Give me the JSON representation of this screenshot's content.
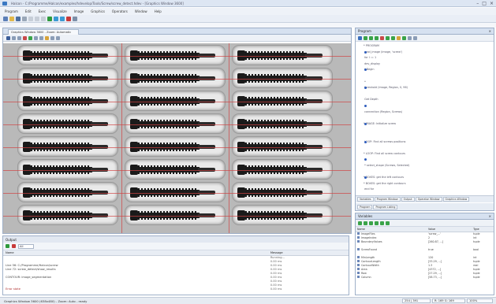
{
  "window": {
    "title": "Halcon - C:/Programme/Halcon/examples/hdevelop/Tools/Screw/screw_detect.hdev - [Graphics Window 3600]",
    "controls": [
      "minimize-icon",
      "maximize-icon",
      "close-icon"
    ]
  },
  "menu": [
    "Program",
    "Edit",
    "Exec",
    "Visualize",
    "Image",
    "Graphics",
    "Operators",
    "Window",
    "Help"
  ],
  "image_window": {
    "tab_label": "Graphics Window 3600 - Zoom: Automatic"
  },
  "output": {
    "title": "Output",
    "mode": "All",
    "columns": [
      "Name",
      "Message"
    ],
    "rows": [
      {
        "name": "",
        "message": "Running..."
      },
      {
        "name": "",
        "message": "0.00 ms"
      },
      {
        "name": "Line 56: C:/Programme/Halcon/screw",
        "message": "0.00 ms"
      },
      {
        "name": "Line 72: screw_detect/show_results",
        "message": "0.00 ms"
      },
      {
        "name": "",
        "message": "0.00 ms"
      },
      {
        "name": "CONTOUR: image_segmentation",
        "message": "0.00 ms"
      },
      {
        "name": "",
        "message": "0.00 ms"
      },
      {
        "name": "",
        "message": "0.00 ms"
      },
      {
        "name": "Error state",
        "message": "0.00 ms"
      }
    ]
  },
  "program": {
    "title": "Program",
    "lines": [
      "* PROGRAM",
      "  read_image (Image, 'screw')",
      "  for I := 1",
      "  dev_display",
      "  * Begin",
      "",
      "  * ",
      "  threshold (Image, Region, 0, 96)",
      "",
      "  Get Depth",
      "",
      "  connection (Region, Screws)",
      "",
      "* IMAGE: Initialize screw",
      "",
      "",
      "  LOOP: Find all screws positions",
      "",
      "* LOOP: Find all screw contours",
      "",
      "  * select_shape (Screws, Selected)",
      "",
      "* BOXES: get the left contours",
      "* BOXES: get the right contours",
      "  end for"
    ],
    "tabs_row1": [
      "Variables",
      "Program Window",
      "Output",
      "Operator Window",
      "Graphics Window"
    ],
    "tabs_row2": [
      "Program",
      "Program Listing"
    ]
  },
  "variables": {
    "title": "Variables",
    "columns": [
      "Name",
      "Value",
      "Type"
    ],
    "rows": [
      {
        "name": "ImageFiles",
        "value": "'screw_...'",
        "type": "tuple"
      },
      {
        "name": "ImageIndex",
        "value": "2",
        "type": "int"
      },
      {
        "name": "BoundaryValues",
        "value": "[260.87, ...]",
        "type": "tuple"
      },
      {
        "name": "",
        "value": "",
        "type": ""
      },
      {
        "name": "ScrewFound",
        "value": "true",
        "type": "bool"
      },
      {
        "name": "",
        "value": "",
        "type": ""
      },
      {
        "name": "MinLength",
        "value": "120",
        "type": "int"
      },
      {
        "name": "ContourLength",
        "value": "[33.29, ...]",
        "type": "tuple"
      },
      {
        "name": "ContourWidth",
        "value": "1.3",
        "type": "real"
      },
      {
        "name": "Area",
        "value": "[4372, ...]",
        "type": "tuple"
      },
      {
        "name": "Row",
        "value": "[27.29, ...]",
        "type": "tuple"
      },
      {
        "name": "Column",
        "value": "[58.73, ...]",
        "type": "tuple"
      }
    ]
  },
  "statusbar": {
    "text": "Graphics Window 3600 (638x480) - Zoom: Auto - ready",
    "coords": "254 | 391",
    "rgb": "R: 169 G: 169",
    "zoom": "100%"
  },
  "colors": {
    "titlebar": "#dde6f3",
    "image_background": "#b9b9b9",
    "screw": "#1a1a1a",
    "region_line": "#d04444"
  }
}
